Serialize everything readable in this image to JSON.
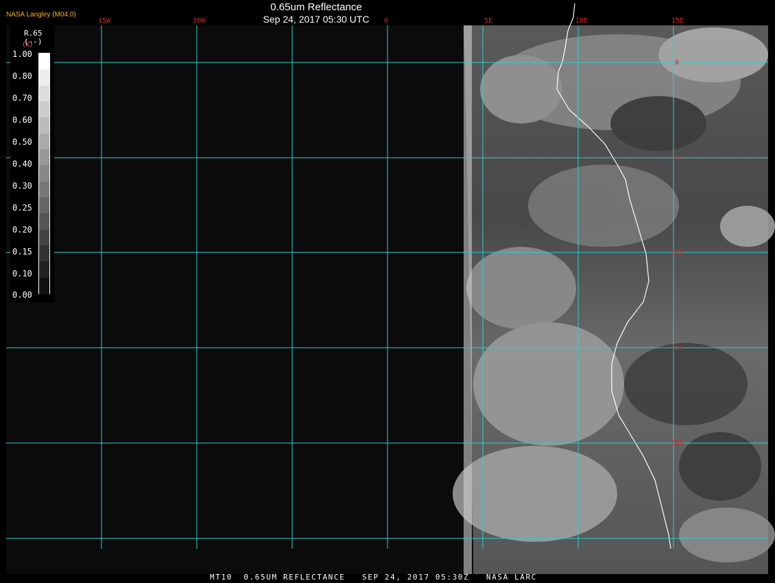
{
  "header": {
    "credit": "NASA Langley (M04.0)",
    "title": "0.65um Reflectance",
    "subtitle": "Sep 24, 2017 05:30 UTC"
  },
  "footer": {
    "text": "MT10  0.65UM REFLECTANCE   SEP 24, 2017 05:30Z   NASA LARC"
  },
  "legend": {
    "title": "R.65",
    "units": "(--)",
    "marker": "(K)",
    "ticks": [
      "1.00",
      "0.80",
      "0.70",
      "0.60",
      "0.50",
      "0.40",
      "0.30",
      "0.25",
      "0.20",
      "0.15",
      "0.10",
      "0.00"
    ],
    "segments": [
      "#ffffff",
      "#eeeeee",
      "#dddddd",
      "#cccccc",
      "#bbbbbb",
      "#aaaaaa",
      "#999999",
      "#888888",
      "#777777",
      "#666666",
      "#555555",
      "#444444",
      "#333333",
      "#222222",
      "#111111"
    ]
  },
  "map": {
    "longitude_labels": [
      "15W",
      "10W",
      "0",
      "5E",
      "10E",
      "15E"
    ],
    "latitude_labels": [
      "0",
      "5S",
      "10S",
      "15S",
      "20S"
    ],
    "grid_color": "#22d4d4",
    "label_color": "#dd2222",
    "coastline_color": "#ffffff"
  }
}
